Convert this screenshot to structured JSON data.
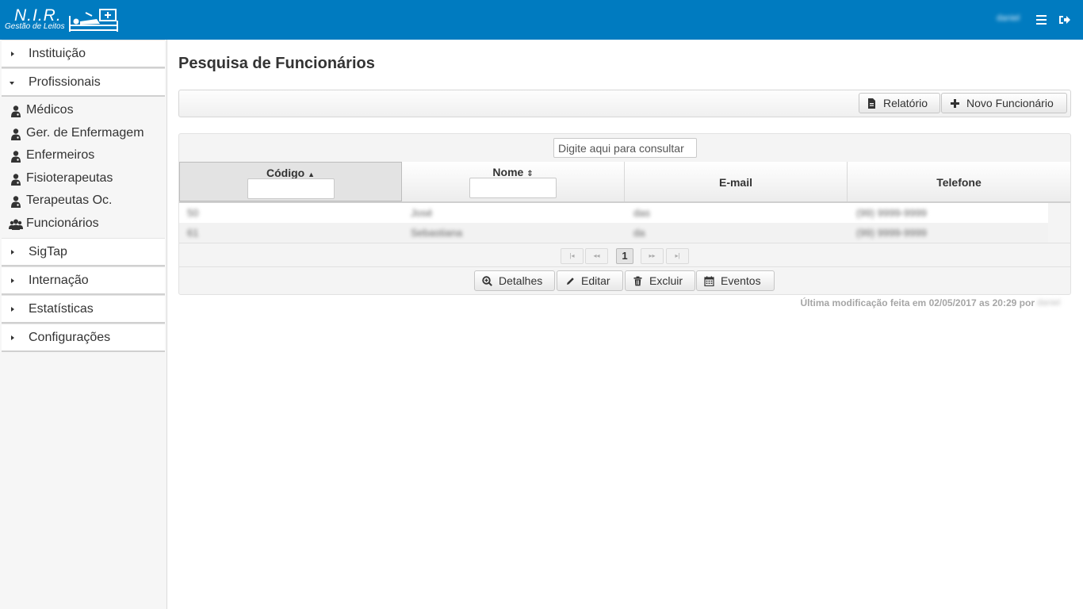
{
  "brand": {
    "title": "N.I.R.",
    "subtitle": "Gestão de Leitos",
    "logo_icon": "hospital-bed-icon"
  },
  "topbar": {
    "user": "daniel",
    "color": "#007bc0",
    "menu_icon": "hamburger-icon",
    "logout_icon": "sign-out-icon"
  },
  "sidebar": {
    "sections": [
      {
        "label": "Instituição",
        "expanded": false
      },
      {
        "label": "Profissionais",
        "expanded": true,
        "items": [
          {
            "label": "Médicos",
            "icon": "user-md-icon"
          },
          {
            "label": "Ger. de Enfermagem",
            "icon": "user-md-icon"
          },
          {
            "label": "Enfermeiros",
            "icon": "user-md-icon"
          },
          {
            "label": "Fisioterapeutas",
            "icon": "user-md-icon"
          },
          {
            "label": "Terapeutas Oc.",
            "icon": "user-md-icon"
          },
          {
            "label": "Funcionários",
            "icon": "users-icon"
          }
        ]
      },
      {
        "label": "SigTap",
        "expanded": false
      },
      {
        "label": "Internação",
        "expanded": false
      },
      {
        "label": "Estatísticas",
        "expanded": false
      },
      {
        "label": "Configurações",
        "expanded": false
      }
    ]
  },
  "main": {
    "title": "Pesquisa de Funcionários",
    "toolbar": {
      "report_label": "Relatório",
      "new_label": "Novo Funcionário"
    },
    "table": {
      "search_placeholder": "Digite aqui para consultar",
      "columns": [
        "Código",
        "Nome",
        "E-mail",
        "Telefone"
      ],
      "rows": [
        [
          "50",
          "José",
          "das",
          "(99) 9999-9999"
        ],
        [
          "61",
          "Sebastiana",
          "da",
          "(99) 9999-9999"
        ]
      ],
      "pagination": {
        "first": "|◂",
        "prev": "◂◂",
        "current": "1",
        "next": "▸▸",
        "last": "▸|"
      },
      "actions": {
        "details": "Detalhes",
        "edit": "Editar",
        "delete": "Excluir",
        "events": "Eventos"
      }
    },
    "last_modified": "Última modificação feita em 02/05/2017 as 20:29 por",
    "last_modified_user": "daniel"
  }
}
